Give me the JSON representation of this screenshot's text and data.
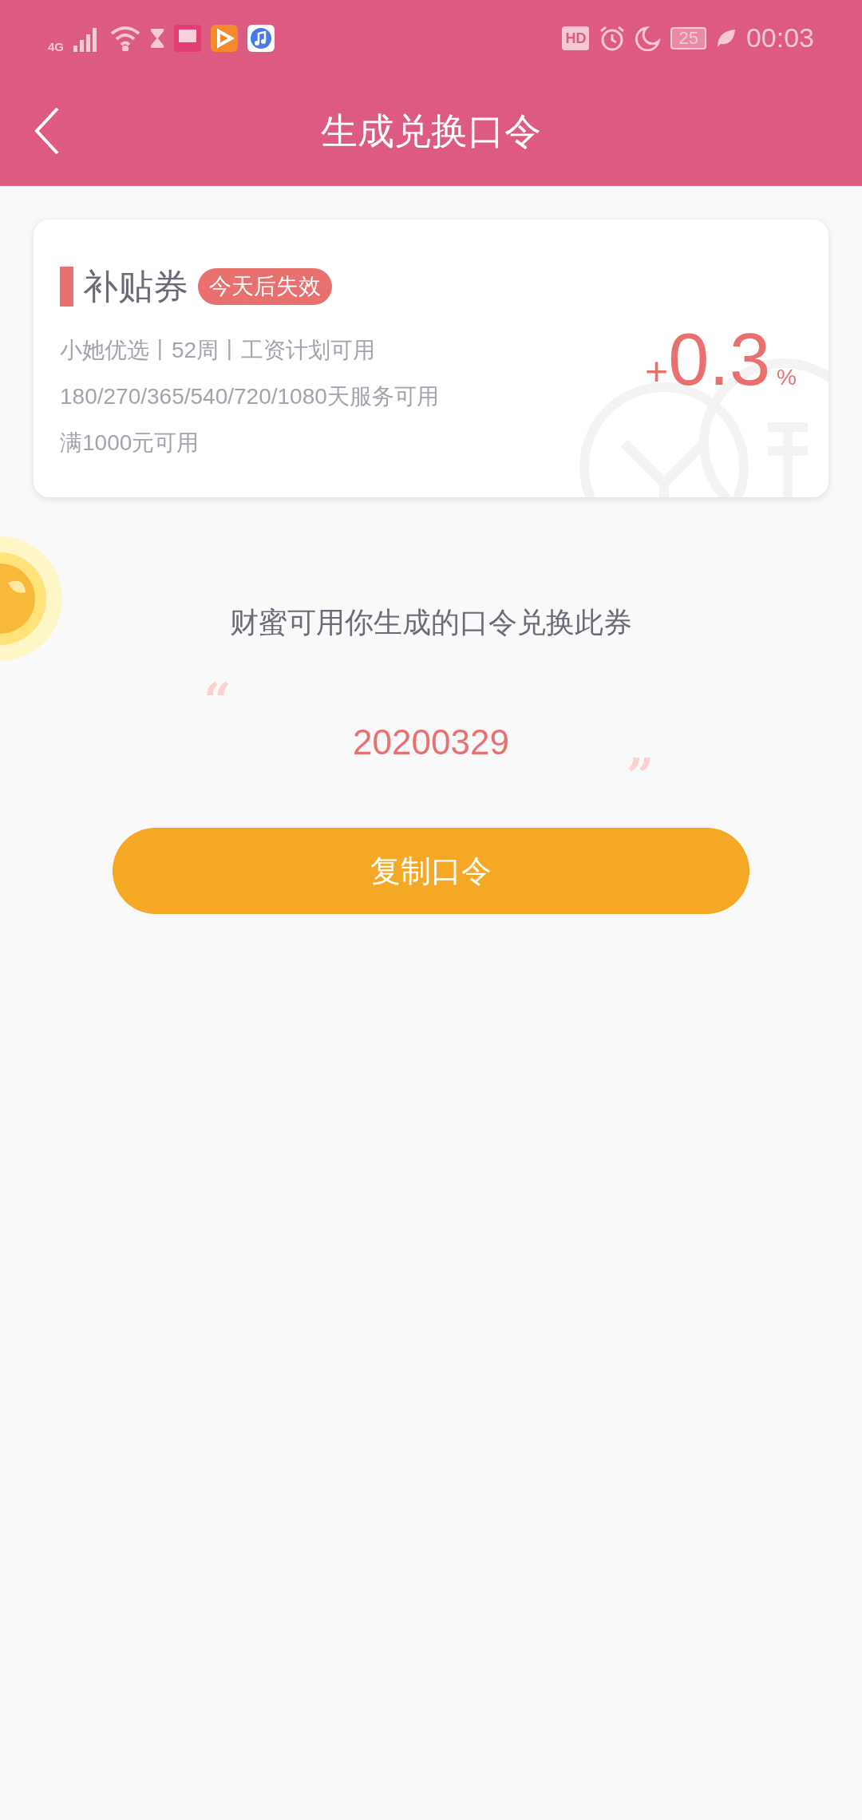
{
  "status_bar": {
    "network": "4G",
    "hd": "HD",
    "battery": "25",
    "time": "00:03"
  },
  "header": {
    "title": "生成兑换口令"
  },
  "coupon": {
    "title": "补贴券",
    "tag": "今天后失效",
    "details": [
      "小她优选丨52周丨工资计划可用",
      "180/270/365/540/720/1080天服务可用",
      "满1000元可用"
    ],
    "sign": "+",
    "rate": "0.3",
    "unit": "%"
  },
  "hint": "财蜜可用你生成的口令兑换此券",
  "code": {
    "open_quote": "“",
    "value": "20200329",
    "close_quote": "”"
  },
  "button": "复制口令"
}
